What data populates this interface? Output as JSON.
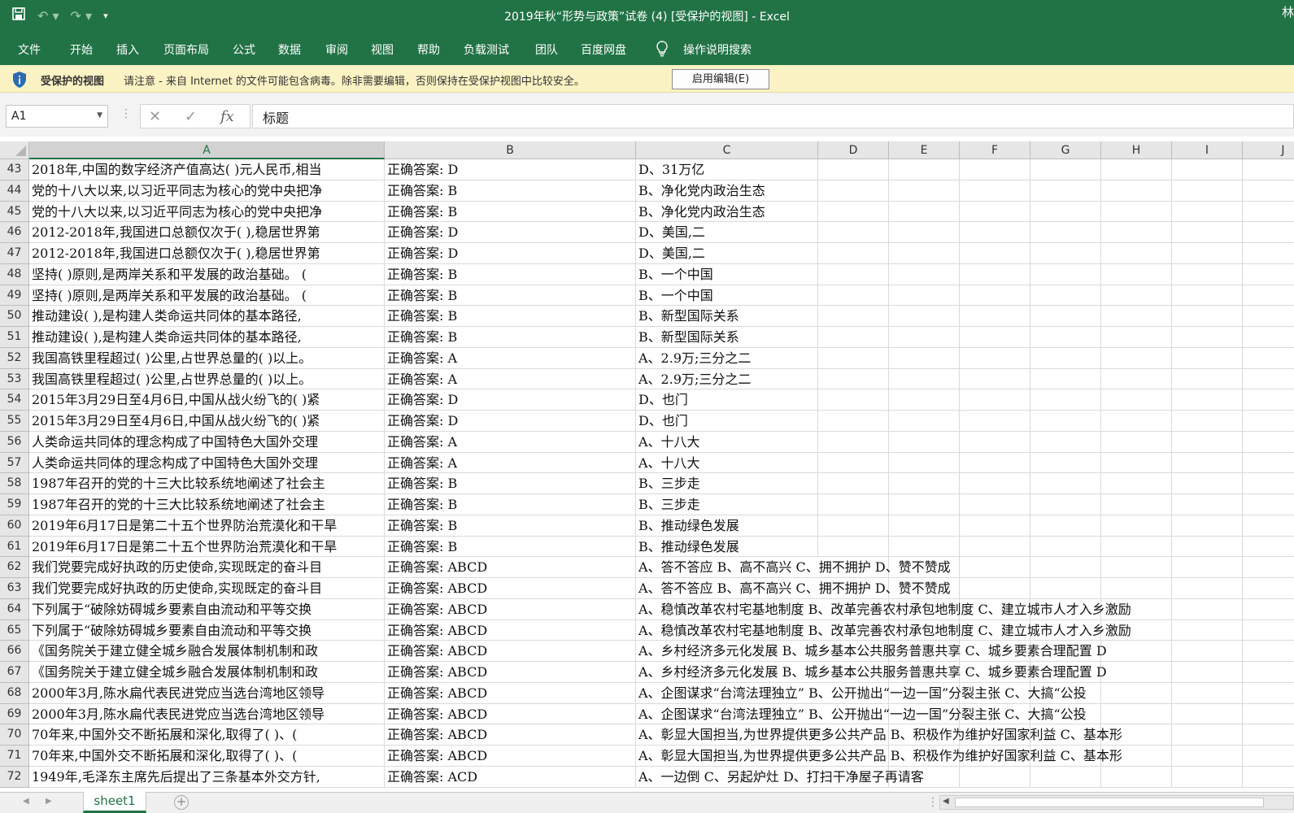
{
  "app": {
    "title": "2019年秋“形势与政策”试卷 (4)  [受保护的视图]  -  Excel",
    "title_cut": "林"
  },
  "ribbon": {
    "tabs": [
      "文件",
      "开始",
      "插入",
      "页面布局",
      "公式",
      "数据",
      "审阅",
      "视图",
      "帮助",
      "负载测试",
      "团队",
      "百度网盘"
    ],
    "search_label": "操作说明搜索"
  },
  "protected_view": {
    "title": "受保护的视图",
    "message": "请注意 - 来自 Internet 的文件可能包含病毒。除非需要编辑，否则保持在受保护视图中比较安全。",
    "button": "启用编辑(E)"
  },
  "formula_bar": {
    "name_box": "A1",
    "formula": "标题"
  },
  "columns": [
    "A",
    "B",
    "C",
    "D",
    "E",
    "F",
    "G",
    "H",
    "I",
    "J"
  ],
  "selected_column": "A",
  "rows": [
    {
      "n": "43",
      "a": "2018年,中国的数字经济产值高达( )元人民币,相当",
      "b": "正确答案:  D",
      "c": "D、31万亿"
    },
    {
      "n": "44",
      "a": "党的十八大以来,以习近平同志为核心的党中央把净",
      "b": "正确答案:  B",
      "c": "B、净化党内政治生态"
    },
    {
      "n": "45",
      "a": "党的十八大以来,以习近平同志为核心的党中央把净",
      "b": "正确答案:  B",
      "c": "B、净化党内政治生态"
    },
    {
      "n": "46",
      "a": "2012-2018年,我国进口总额仅次于( ),稳居世界第",
      "b": "正确答案:  D",
      "c": "D、美国,二"
    },
    {
      "n": "47",
      "a": "2012-2018年,我国进口总额仅次于( ),稳居世界第",
      "b": "正确答案:  D",
      "c": "D、美国,二"
    },
    {
      "n": "48",
      "a": "坚持( )原则,是两岸关系和平发展的政治基础。 (",
      "b": "正确答案:  B",
      "c": "B、一个中国"
    },
    {
      "n": "49",
      "a": "坚持( )原则,是两岸关系和平发展的政治基础。 (",
      "b": "正确答案:  B",
      "c": "B、一个中国"
    },
    {
      "n": "50",
      "a": "推动建设(  ),是构建人类命运共同体的基本路径,",
      "b": "正确答案:  B",
      "c": "B、新型国际关系"
    },
    {
      "n": "51",
      "a": "推动建设(  ),是构建人类命运共同体的基本路径,",
      "b": "正确答案:  B",
      "c": "B、新型国际关系"
    },
    {
      "n": "52",
      "a": "我国高铁里程超过( )公里,占世界总量的( )以上。",
      "b": "正确答案:  A",
      "c": "A、2.9万;三分之二"
    },
    {
      "n": "53",
      "a": "我国高铁里程超过( )公里,占世界总量的( )以上。",
      "b": "正确答案:  A",
      "c": "A、2.9万;三分之二"
    },
    {
      "n": "54",
      "a": "2015年3月29日至4月6日,中国从战火纷飞的(  )紧",
      "b": "正确答案:  D",
      "c": "D、也门"
    },
    {
      "n": "55",
      "a": "2015年3月29日至4月6日,中国从战火纷飞的(  )紧",
      "b": "正确答案:  D",
      "c": "D、也门"
    },
    {
      "n": "56",
      "a": "人类命运共同体的理念构成了中国特色大国外交理",
      "b": "正确答案:  A",
      "c": "A、十八大"
    },
    {
      "n": "57",
      "a": "人类命运共同体的理念构成了中国特色大国外交理",
      "b": "正确答案:  A",
      "c": "A、十八大"
    },
    {
      "n": "58",
      "a": "1987年召开的党的十三大比较系统地阐述了社会主",
      "b": "正确答案:  B",
      "c": "B、三步走"
    },
    {
      "n": "59",
      "a": "1987年召开的党的十三大比较系统地阐述了社会主",
      "b": "正确答案:  B",
      "c": "B、三步走"
    },
    {
      "n": "60",
      "a": "2019年6月17日是第二十五个世界防治荒漠化和干旱",
      "b": "正确答案:  B",
      "c": "B、推动绿色发展"
    },
    {
      "n": "61",
      "a": "2019年6月17日是第二十五个世界防治荒漠化和干旱",
      "b": "正确答案:  B",
      "c": "B、推动绿色发展"
    },
    {
      "n": "62",
      "a": "我们党要完成好执政的历史使命,实现既定的奋斗目",
      "b": "正确答案:  ABCD",
      "c": "A、答不答应     B、高不高兴     C、拥不拥护     D、赞不赞成"
    },
    {
      "n": "63",
      "a": "我们党要完成好执政的历史使命,实现既定的奋斗目",
      "b": "正确答案:  ABCD",
      "c": "A、答不答应     B、高不高兴     C、拥不拥护     D、赞不赞成"
    },
    {
      "n": "64",
      "a": "下列属于“破除妨碍城乡要素自由流动和平等交换",
      "b": "正确答案:  ABCD",
      "c": "A、稳慎改革农村宅基地制度     B、改革完善农村承包地制度     C、建立城市人才入乡激励"
    },
    {
      "n": "65",
      "a": "下列属于“破除妨碍城乡要素自由流动和平等交换",
      "b": "正确答案:  ABCD",
      "c": "A、稳慎改革农村宅基地制度     B、改革完善农村承包地制度     C、建立城市人才入乡激励"
    },
    {
      "n": "66",
      "a": "《国务院关于建立健全城乡融合发展体制机制和政",
      "b": "正确答案:  ABCD",
      "c": "A、乡村经济多元化发展     B、城乡基本公共服务普惠共享     C、城乡要素合理配置     D"
    },
    {
      "n": "67",
      "a": "《国务院关于建立健全城乡融合发展体制机制和政",
      "b": "正确答案:  ABCD",
      "c": "A、乡村经济多元化发展     B、城乡基本公共服务普惠共享     C、城乡要素合理配置     D"
    },
    {
      "n": "68",
      "a": "2000年3月,陈水扁代表民进党应当选台湾地区领导",
      "b": "正确答案:  ABCD",
      "c": "A、企图谋求“台湾法理独立”     B、公开抛出“一边一国”分裂主张     C、大搞“公投"
    },
    {
      "n": "69",
      "a": "2000年3月,陈水扁代表民进党应当选台湾地区领导",
      "b": "正确答案:  ABCD",
      "c": "A、企图谋求“台湾法理独立”     B、公开抛出“一边一国”分裂主张     C、大搞“公投"
    },
    {
      "n": "70",
      "a": "70年来,中国外交不断拓展和深化,取得了(  )、(",
      "b": "正确答案:  ABCD",
      "c": "A、彰显大国担当,为世界提供更多公共产品     B、积极作为维护好国家利益     C、基本形"
    },
    {
      "n": "71",
      "a": "70年来,中国外交不断拓展和深化,取得了(  )、(",
      "b": "正确答案:  ABCD",
      "c": "A、彰显大国担当,为世界提供更多公共产品     B、积极作为维护好国家利益     C、基本形"
    },
    {
      "n": "72",
      "a": "1949年,毛泽东主席先后提出了三条基本外交方针,",
      "b": "正确答案:  ACD",
      "c": "A、一边倒     C、另起炉灶     D、打扫干净屋子再请客"
    }
  ],
  "sheet_tabs": [
    "sheet1"
  ],
  "colors": {
    "excel_green": "#217346",
    "protect_bar": "#fcf3c4"
  }
}
